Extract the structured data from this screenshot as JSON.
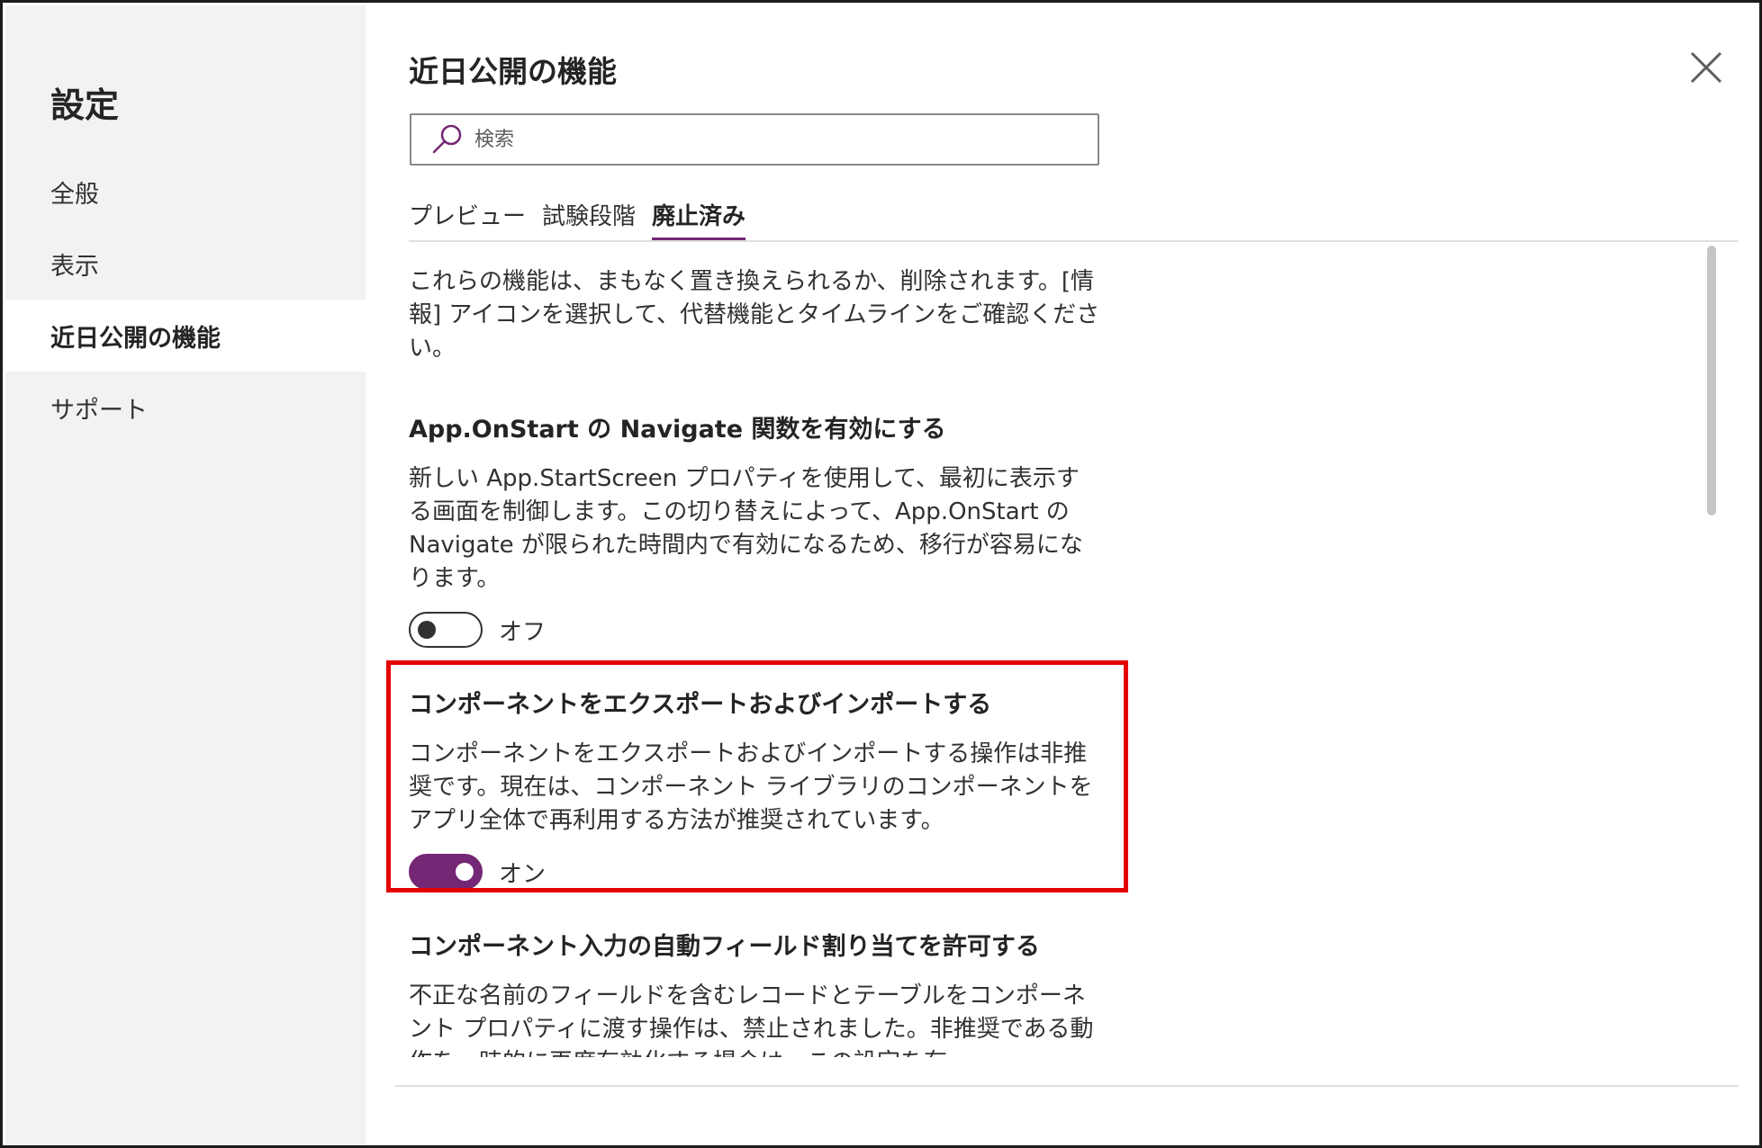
{
  "sidebar": {
    "title": "設定",
    "items": [
      {
        "label": "全般",
        "active": false
      },
      {
        "label": "表示",
        "active": false
      },
      {
        "label": "近日公開の機能",
        "active": true
      },
      {
        "label": "サポート",
        "active": false
      }
    ]
  },
  "main": {
    "title": "近日公開の機能",
    "close_icon": "close-icon",
    "search": {
      "placeholder": "検索",
      "value": "",
      "icon": "search-icon"
    },
    "tabs": [
      {
        "label": "プレビュー",
        "active": false
      },
      {
        "label": "試験段階",
        "active": false
      },
      {
        "label": "廃止済み",
        "active": true
      }
    ],
    "intro": "これらの機能は、まもなく置き換えられるか、削除されます。[情報] アイコンを選択して、代替機能とタイムラインをご確認ください。",
    "features": [
      {
        "title": "App.OnStart の Navigate 関数を有効にする",
        "description": "新しい App.StartScreen プロパティを使用して、最初に表示する画面を制御します。この切り替えによって、App.OnStart の Navigate が限られた時間内で有効になるため、移行が容易になります。",
        "toggle_state": "off",
        "toggle_label": "オフ"
      },
      {
        "title": "コンポーネントをエクスポートおよびインポートする",
        "description": "コンポーネントをエクスポートおよびインポートする操作は非推奨です。現在は、コンポーネント ライブラリのコンポーネントをアプリ全体で再利用する方法が推奨されています。",
        "toggle_state": "on",
        "toggle_label": "オン"
      },
      {
        "title": "コンポーネント入力の自動フィールド割り当てを許可する",
        "description": "不正な名前のフィールドを含むレコードとテーブルをコンポーネント プロパティに渡す操作は、禁止されました。非推奨である動作を一時的に再度有効化する場合は、この設定を有"
      }
    ]
  },
  "colors": {
    "accent": "#742774",
    "highlight": "#e50000",
    "sidebar_bg": "#f3f2f1"
  }
}
